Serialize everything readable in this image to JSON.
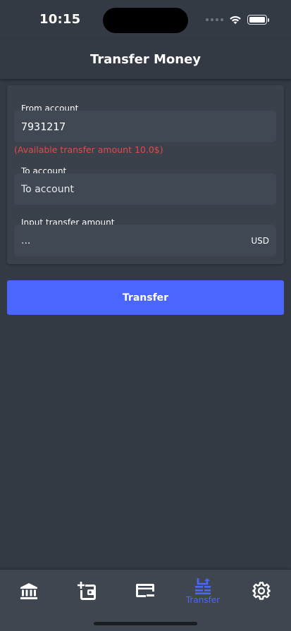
{
  "status_bar": {
    "time": "10:15"
  },
  "header": {
    "title": "Transfer Money"
  },
  "form": {
    "from_label": "From account",
    "from_value": "7931217",
    "available_note": "(Available transfer amount 10.0$)",
    "to_label": "To account",
    "to_placeholder": "To account",
    "amount_label": "Input transfer amount",
    "amount_placeholder": "...",
    "currency": "USD"
  },
  "actions": {
    "transfer_label": "Transfer"
  },
  "tabbar": {
    "active_label": "Transfer",
    "items": [
      {
        "icon": "bank-icon"
      },
      {
        "icon": "add-wallet-icon"
      },
      {
        "icon": "card-icon"
      },
      {
        "icon": "transfer-icon",
        "label": "Transfer"
      },
      {
        "icon": "gear-icon"
      }
    ]
  },
  "colors": {
    "background": "#343a43",
    "accent": "#4a66ff",
    "warning": "#e2494d"
  }
}
